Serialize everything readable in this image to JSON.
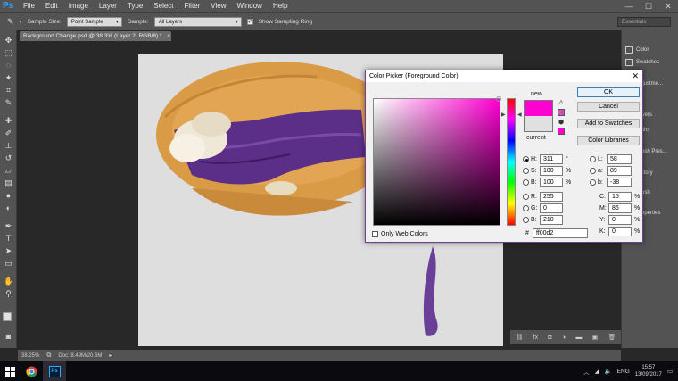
{
  "app": {
    "logo": "Ps",
    "menu": [
      "File",
      "Edit",
      "Image",
      "Layer",
      "Type",
      "Select",
      "Filter",
      "View",
      "Window",
      "Help"
    ],
    "window_controls": [
      "—",
      "☐",
      "✕"
    ]
  },
  "options_bar": {
    "sample_size_label": "Sample Size:",
    "sample_size_value": "Point Sample",
    "sample_label": "Sample:",
    "sample_value": "All Layers",
    "show_ring_label": "Show Sampling Ring",
    "workspace": "Essentials"
  },
  "document": {
    "tab_title": "Background Change.psd @ 38.3% (Layer 2, RGB/8) *",
    "zoom": "38.25%",
    "doc_info": "Doc: 8.49M/20.6M"
  },
  "right_panel": {
    "items": [
      "Color",
      "Swatches",
      "Adjustme...",
      "Layers",
      "Paths",
      "Brush Pres...",
      "History",
      "Brush",
      "Properties"
    ]
  },
  "color_picker": {
    "title": "Color Picker (Foreground Color)",
    "new_label": "new",
    "current_label": "current",
    "new_color": "#ff00d2",
    "current_color": "#e0e0e0",
    "buttons": {
      "ok": "OK",
      "cancel": "Cancel",
      "add_swatches": "Add to Swatches",
      "libraries": "Color Libraries"
    },
    "hsb": {
      "h_label": "H:",
      "h_value": "311",
      "h_unit": "°",
      "s_label": "S:",
      "s_value": "100",
      "s_unit": "%",
      "b_label": "B:",
      "b_value": "100",
      "b_unit": "%"
    },
    "rgb": {
      "r_label": "R:",
      "r_value": "255",
      "g_label": "G:",
      "g_value": "0",
      "b_label": "B:",
      "b_value": "210"
    },
    "lab": {
      "l_label": "L:",
      "l_value": "58",
      "a_label": "a:",
      "a_value": "89",
      "b_label": "b:",
      "b_value": "-38"
    },
    "cmyk": {
      "c_label": "C:",
      "c_value": "15",
      "c_unit": "%",
      "m_label": "M:",
      "m_value": "86",
      "m_unit": "%",
      "y_label": "Y:",
      "y_value": "0",
      "y_unit": "%",
      "k_label": "K:",
      "k_value": "0",
      "k_unit": "%"
    },
    "hex_label": "#",
    "hex_value": "ff00d2",
    "web_colors_label": "Only Web Colors"
  },
  "taskbar": {
    "language": "ENG",
    "time": "15:57",
    "date": "13/09/2017",
    "notification_count": "1"
  }
}
